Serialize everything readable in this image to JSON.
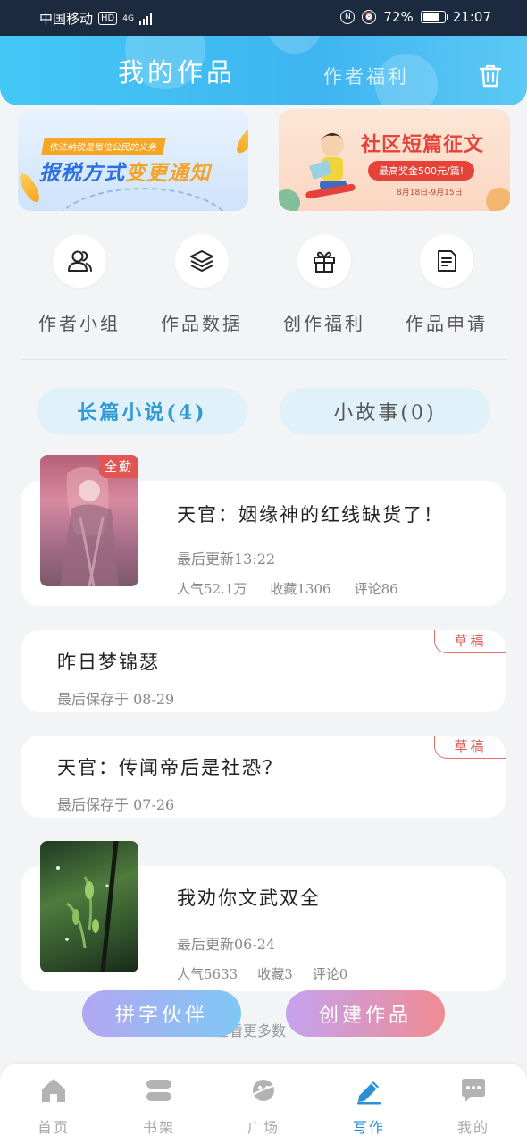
{
  "status_bar": {
    "carrier": "中国移动",
    "hd": "HD",
    "network": "4G",
    "battery": "72%",
    "time": "21:07"
  },
  "header": {
    "active_tab": "我的作品",
    "other_tab": "作者福利"
  },
  "banners": [
    {
      "tag": "依法纳税是每位公民的义务",
      "headline_a": "报税方式",
      "headline_b": "变更通知"
    },
    {
      "title": "社区短篇征文",
      "prize": "最高奖金500元/篇!",
      "dates": "8月18日-9月15日"
    }
  ],
  "shortcuts": [
    {
      "label": "作者小组",
      "icon": "people-icon"
    },
    {
      "label": "作品数据",
      "icon": "layers-icon"
    },
    {
      "label": "创作福利",
      "icon": "gift-icon"
    },
    {
      "label": "作品申请",
      "icon": "document-icon"
    }
  ],
  "categories": {
    "long": "长篇小说(4)",
    "short": "小故事(0)"
  },
  "works": [
    {
      "title": "天官：姻缘神的红线缺货了！",
      "updated": "最后更新13:22",
      "popularity": "人气52.1万",
      "favorites": "收藏1306",
      "comments": "评论86",
      "badge": "全勤"
    },
    {
      "title": "昨日梦锦瑟",
      "saved": "最后保存于 08-29",
      "status": "草稿"
    },
    {
      "title": "天官：传闻帝后是社恐？",
      "saved": "最后保存于 07-26",
      "status": "草稿"
    },
    {
      "title": "我劝你文武双全",
      "updated": "最后更新06-24",
      "popularity": "人气5633",
      "favorites": "收藏3",
      "comments": "评论0"
    }
  ],
  "more_text": "查看更多数",
  "fab": {
    "left": "拼字伙伴",
    "right": "创建作品"
  },
  "bottom_nav": [
    {
      "label": "首页",
      "icon": "home-icon"
    },
    {
      "label": "书架",
      "icon": "bookshelf-icon"
    },
    {
      "label": "广场",
      "icon": "planet-icon"
    },
    {
      "label": "写作",
      "icon": "pen-icon",
      "active": true
    },
    {
      "label": "我的",
      "icon": "chat-icon"
    }
  ],
  "colors": {
    "accent": "#2a8fd6",
    "header": "#3fb5f0",
    "draft": "#e05a5a",
    "badge": "#e25555"
  }
}
